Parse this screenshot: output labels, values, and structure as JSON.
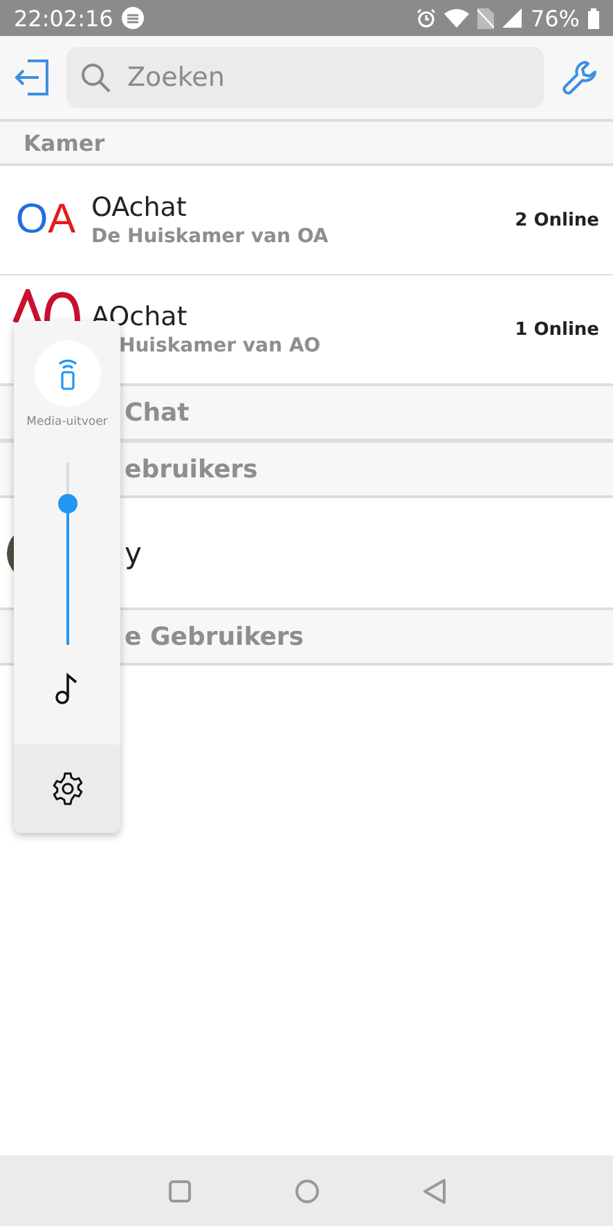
{
  "status_bar": {
    "time": "22:02:16",
    "battery": "76%"
  },
  "header": {
    "search": {
      "placeholder": "Zoeken"
    }
  },
  "sections": [
    {
      "title": "Kamer",
      "rows": [
        {
          "kind": "room",
          "logo": [
            {
              "text": "O",
              "color": "#1f6fe0"
            },
            {
              "text": "A",
              "color": "#e41b1b"
            }
          ],
          "name": "OAchat",
          "subtitle": "De Huiskamer van OA",
          "online": "2 Online"
        },
        {
          "kind": "room",
          "name": "AOchat",
          "subtitle": "Huiskamer van AO",
          "online": "1 Online"
        }
      ]
    },
    {
      "title": "Chat"
    },
    {
      "title": "ebruikers",
      "rows": [
        {
          "kind": "user",
          "name": "y"
        }
      ]
    },
    {
      "title": "e Gebruikers"
    }
  ],
  "volume_panel": {
    "label": "Media-uitvoer",
    "level": 0.77
  }
}
